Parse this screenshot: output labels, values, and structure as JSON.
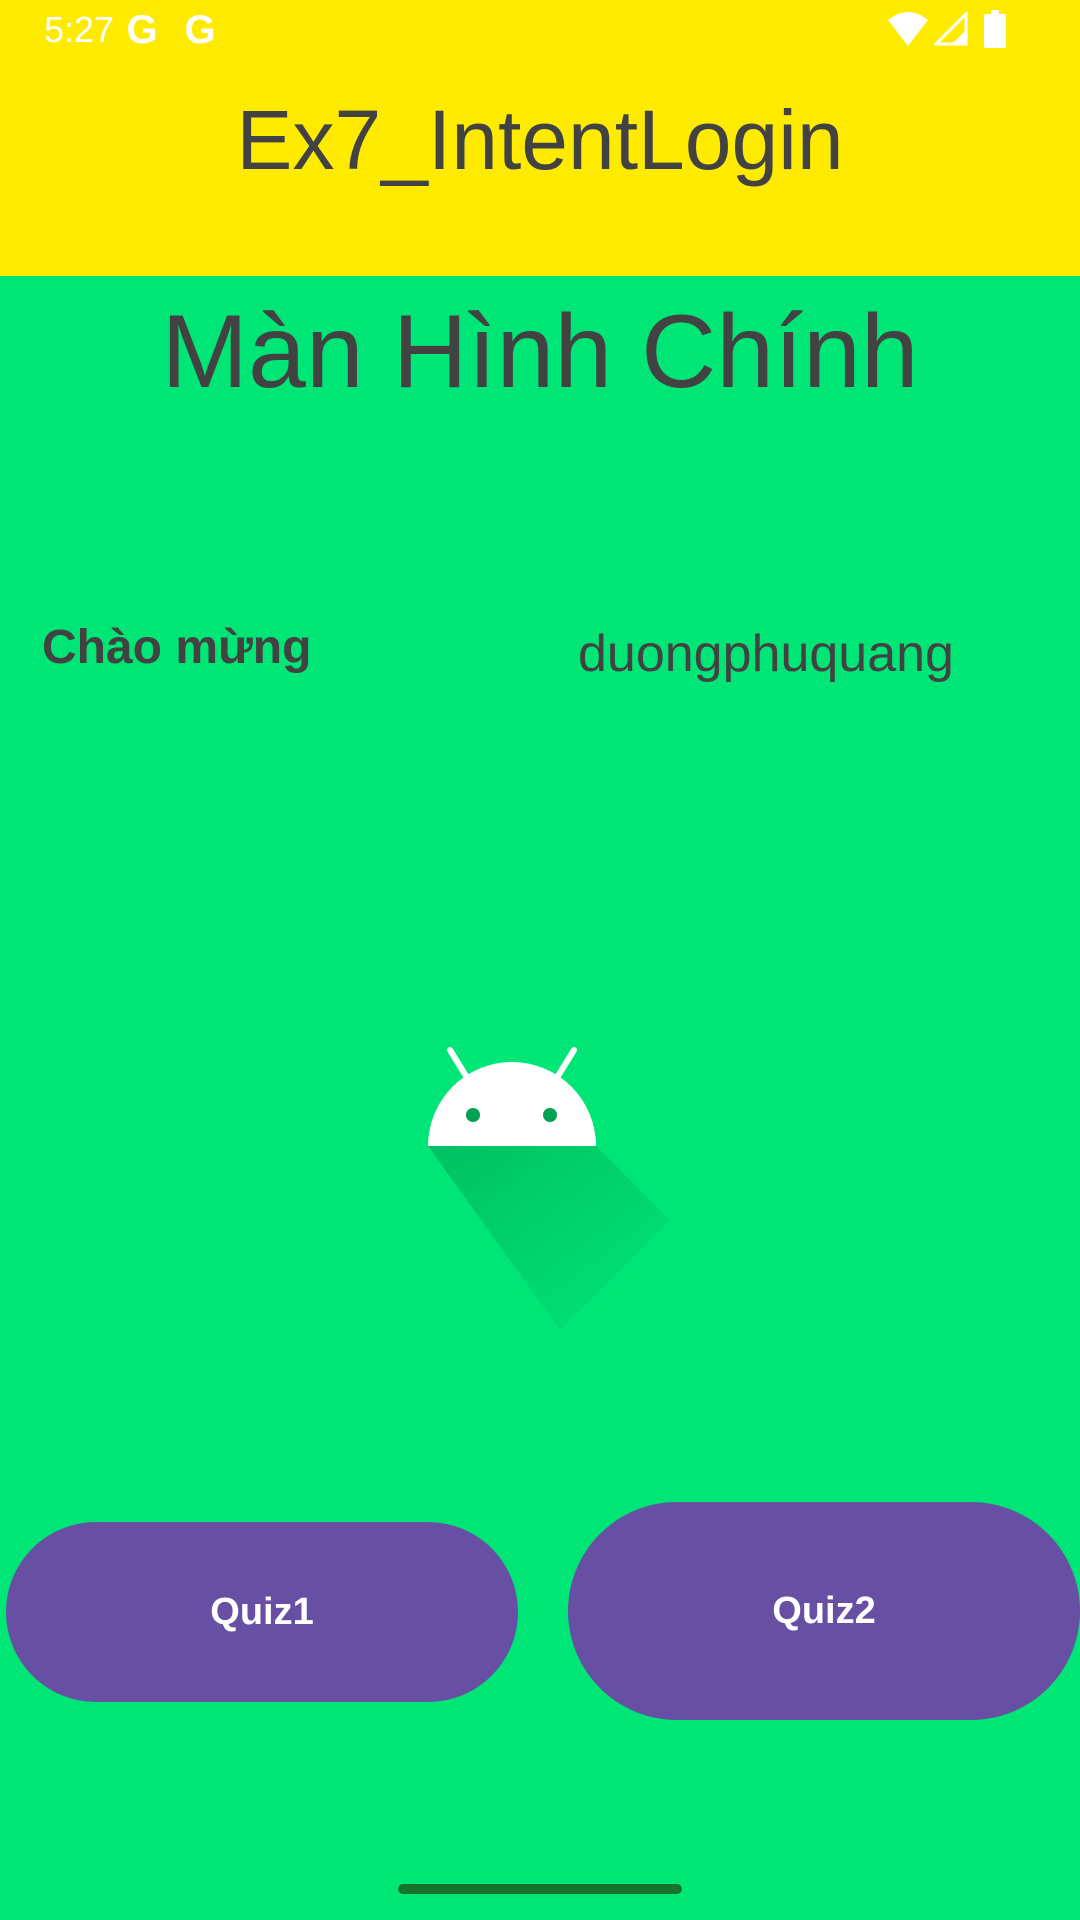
{
  "status_bar": {
    "time": "5:27",
    "g_icon_1": "G",
    "g_icon_2": "G",
    "icons": [
      "wifi-icon",
      "signal-icon",
      "battery-icon"
    ]
  },
  "app_bar": {
    "title": "Ex7_IntentLogin"
  },
  "main": {
    "heading": "Màn Hình Chính",
    "welcome_label": "Chào mừng",
    "username": "duongphuquang",
    "image": "android-logo-icon"
  },
  "buttons": {
    "quiz1_label": "Quiz1",
    "quiz2_label": "Quiz2"
  },
  "colors": {
    "app_bar_background": "#FFEB00",
    "screen_background": "#00E676",
    "button": "#6750A4",
    "text": "#424242"
  }
}
